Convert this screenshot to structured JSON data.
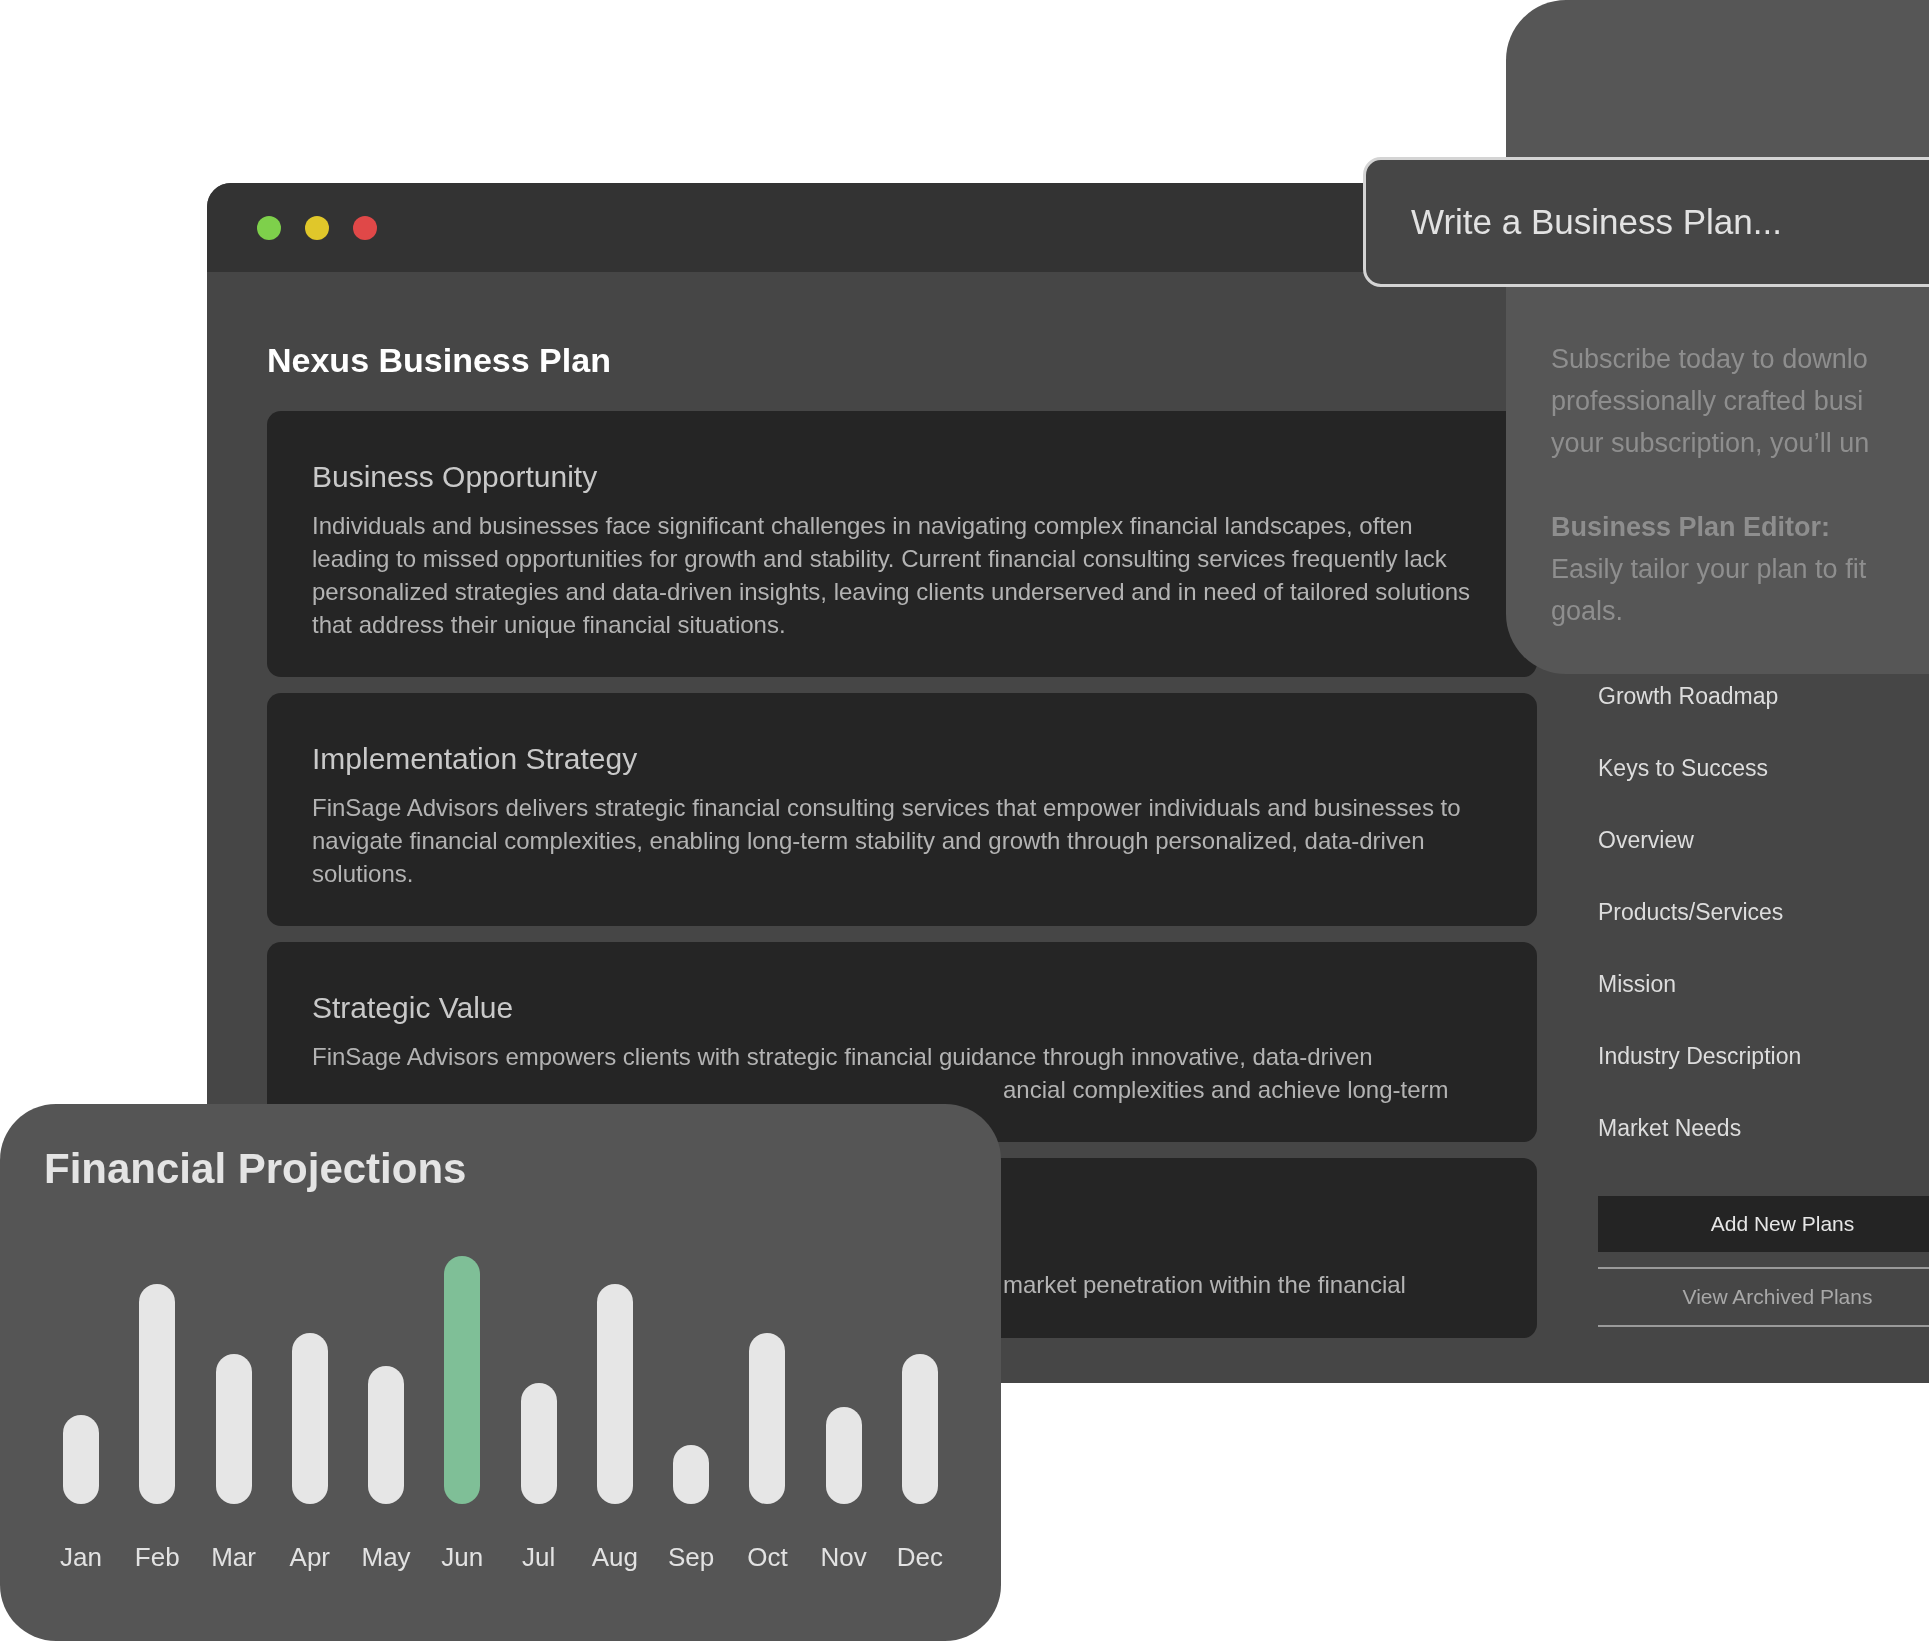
{
  "window": {
    "title": "Nexus Business Plan"
  },
  "sections": [
    {
      "heading": "Business Opportunity",
      "body": "Individuals and businesses face significant challenges in navigating complex financial landscapes, often leading to missed opportunities for growth and stability. Current financial consulting services frequently lack personalized strategies and data-driven insights, leaving clients underserved and in need of tailored solutions that address their unique financial situations."
    },
    {
      "heading": "Implementation Strategy",
      "body": "FinSage Advisors delivers strategic financial consulting services that empower individuals and businesses to navigate financial complexities, enabling long-term stability and growth through personalized, data-driven solutions."
    },
    {
      "heading": "Strategic Value",
      "body": "FinSage Advisors empowers clients with strategic financial guidance through innovative, data-driven",
      "body_fragment": "ancial complexities and achieve long-term"
    },
    {
      "body_fragment": "market penetration within the financial"
    }
  ],
  "sidebar": {
    "items": [
      "Growth Roadmap",
      "Keys to Success",
      "Overview",
      "Products/Services",
      "Mission",
      "Industry Description",
      "Market Needs"
    ],
    "buttons": [
      {
        "label": "Add New Plans",
        "kind": "primary"
      },
      {
        "label": "View Archived Plans",
        "kind": "outline"
      }
    ]
  },
  "prompt": {
    "placeholder": "Write a Business Plan..."
  },
  "subscribe": {
    "lines": [
      "Subscribe today to downlo",
      "professionally crafted busi",
      "your subscription, you’ll un"
    ],
    "feature_title": "Business Plan Editor:",
    "feature_lines": [
      "Easily tailor your plan to fit",
      "goals."
    ]
  },
  "projections": {
    "title": "Financial Projections",
    "months": [
      {
        "label": "Jan",
        "selected": false
      },
      {
        "label": "Feb",
        "selected": false
      },
      {
        "label": "Mar",
        "selected": false
      },
      {
        "label": "Apr",
        "selected": false
      },
      {
        "label": "May",
        "selected": false
      },
      {
        "label": "Jun",
        "selected": true
      },
      {
        "label": "Jul",
        "selected": false
      },
      {
        "label": "Aug",
        "selected": false
      },
      {
        "label": "Sep",
        "selected": false
      },
      {
        "label": "Oct",
        "selected": false
      },
      {
        "label": "Nov",
        "selected": false
      },
      {
        "label": "Dec",
        "selected": false
      }
    ]
  }
}
